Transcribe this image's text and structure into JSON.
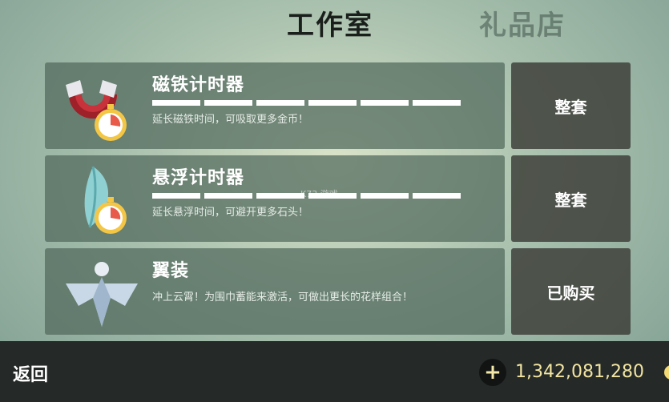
{
  "tabs": {
    "active": "工作室",
    "inactive": "礼品店"
  },
  "rows": [
    {
      "title": "磁铁计时器",
      "description": "延长磁铁时间，可吸取更多金币！",
      "action": "整套",
      "icon": "magnet-timer-icon",
      "progress_segments": 6
    },
    {
      "title": "悬浮计时器",
      "description": "延长悬浮时间，可避开更多石头！",
      "action": "整套",
      "icon": "feather-timer-icon",
      "progress_segments": 6
    },
    {
      "title": "翼装",
      "description": "冲上云霄！为围巾蓄能来激活，可做出更长的花样组合！",
      "action": "已购买",
      "icon": "wingsuit-icon"
    }
  ],
  "watermark": "K73 游戏",
  "footer": {
    "back": "返回",
    "plus": "+",
    "coins": "1,342,081,280"
  },
  "colors": {
    "coin_text": "#f2e4a2",
    "row_bg": "#50685c",
    "button_bg": "#3e403a"
  }
}
